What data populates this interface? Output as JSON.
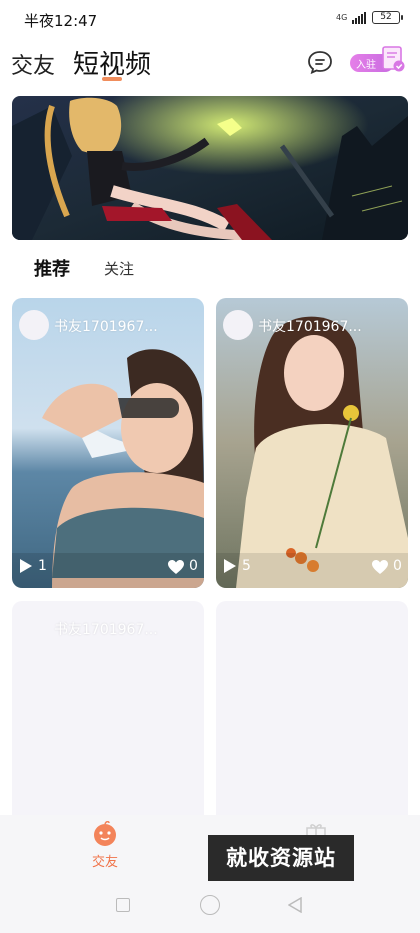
{
  "status_bar": {
    "time": "半夜12:47",
    "network": "4G",
    "battery": "52"
  },
  "header": {
    "tab_friends": "交友",
    "tab_video": "短视频",
    "join_label": "入驻"
  },
  "sub_tabs": {
    "recommend": "推荐",
    "follow": "关注"
  },
  "feed": [
    {
      "username": "书友1701967...",
      "plays": "1",
      "likes": "0"
    },
    {
      "username": "书友1701967...",
      "plays": "5",
      "likes": "0"
    },
    {
      "username": "书友1701967..."
    }
  ],
  "bottom_nav": {
    "friends_label": "交友",
    "watermark": "就收资源站"
  },
  "colors": {
    "accent": "#f08d5c",
    "badge": "#d877e4"
  },
  "icons": [
    "message-icon",
    "document-icon",
    "play-icon",
    "heart-icon",
    "friends-nav-icon",
    "gift-icon"
  ]
}
